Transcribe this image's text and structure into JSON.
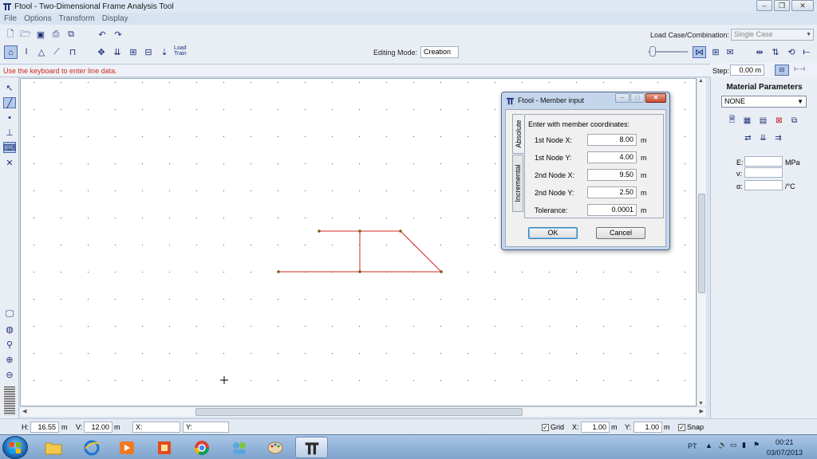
{
  "window": {
    "title": "Ftool - Two-Dimensional Frame Analysis Tool"
  },
  "menu": [
    "File",
    "Options",
    "Transform",
    "Display"
  ],
  "toolbar": {
    "load_train_label_1": "Load",
    "load_train_label_2": "Train",
    "editing_mode_label": "Editing Mode:",
    "editing_mode_value": "Creation",
    "load_case_label": "Load Case/Combination:",
    "load_case_value": "Single Case"
  },
  "message": "Use the keyboard to enter line data.",
  "step": {
    "label": "Step:",
    "value": "0.00 m"
  },
  "material_panel": {
    "title": "Material Parameters",
    "material_value": "NONE",
    "props": [
      {
        "label": "E:",
        "unit": "MPa"
      },
      {
        "label": "ν:",
        "unit": ""
      },
      {
        "label": "α:",
        "unit": "/°C"
      }
    ]
  },
  "dialog": {
    "title": "Ftool - Member input",
    "tab_absolute": "Absolute",
    "tab_incremental": "Incremental",
    "heading": "Enter with member coordinates:",
    "fields": [
      {
        "label": "1st Node X:",
        "value": "8.00",
        "unit": "m"
      },
      {
        "label": "1st Node Y:",
        "value": "4.00",
        "unit": "m"
      },
      {
        "label": "2nd Node X:",
        "value": "9.50",
        "unit": "m"
      },
      {
        "label": "2nd Node Y:",
        "value": "2.50",
        "unit": "m"
      },
      {
        "label": "Tolerance:",
        "value": "0.0001",
        "unit": "m"
      }
    ],
    "ok_label": "OK",
    "cancel_label": "Cancel"
  },
  "status": {
    "h_label": "H:",
    "h_value": "16.55",
    "h_unit": "m",
    "v_label": "V:",
    "v_value": "12.00",
    "v_unit": "m",
    "x_label": "X:",
    "y_label": "Y:",
    "grid_label": "Grid",
    "grid_checked": true,
    "gx_label": "X:",
    "gx_value": "1.00",
    "gx_unit": "m",
    "gy_label": "Y:",
    "gy_value": "1.00",
    "gy_unit": "m",
    "snap_label": "Snap",
    "snap_checked": true
  },
  "taskbar": {
    "apps": [
      "windows-explorer",
      "internet-explorer",
      "media-player",
      "office",
      "chrome",
      "windows-live",
      "paint",
      "ftool"
    ],
    "language": "PT",
    "time": "00:21",
    "date": "03/07/2013"
  }
}
